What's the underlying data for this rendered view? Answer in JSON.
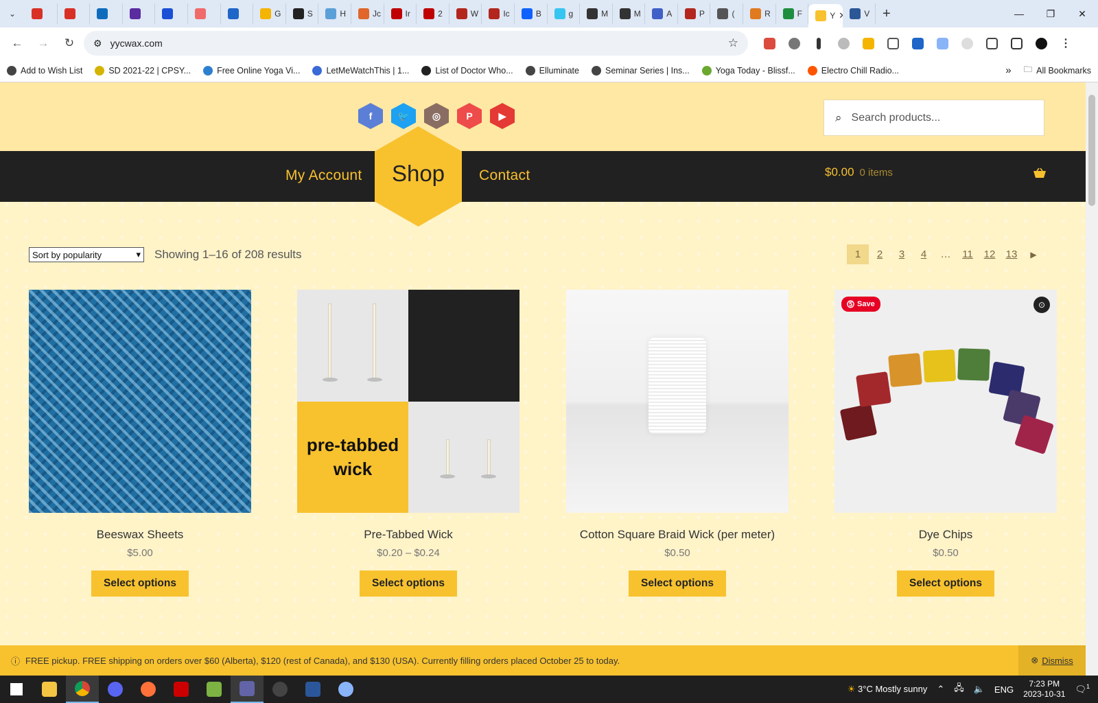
{
  "browser": {
    "tabs": [
      {
        "label": "",
        "color": "#d93025"
      },
      {
        "label": "",
        "color": "#d93025"
      },
      {
        "label": "",
        "color": "#0f6cbd"
      },
      {
        "label": "",
        "color": "#5a2ca0"
      },
      {
        "label": "",
        "color": "#1a4fd6"
      },
      {
        "label": "",
        "color": "#f06a6a"
      },
      {
        "label": "",
        "color": "#1e66c7"
      },
      {
        "label": "G",
        "color": "#f4b400"
      },
      {
        "label": "S",
        "color": "#222222"
      },
      {
        "label": "H",
        "color": "#5aa0d8"
      },
      {
        "label": "Jc",
        "color": "#e0662a"
      },
      {
        "label": "Ir",
        "color": "#c00000"
      },
      {
        "label": "2",
        "color": "#c00000"
      },
      {
        "label": "W",
        "color": "#b3261e"
      },
      {
        "label": "Ic",
        "color": "#b3261e"
      },
      {
        "label": "B",
        "color": "#0f62fe"
      },
      {
        "label": "g",
        "color": "#36c5f0"
      },
      {
        "label": "M",
        "color": "#333333"
      },
      {
        "label": "M",
        "color": "#333333"
      },
      {
        "label": "A",
        "color": "#4060c8"
      },
      {
        "label": "P",
        "color": "#b3261e"
      },
      {
        "label": "(",
        "color": "#555555"
      },
      {
        "label": "R",
        "color": "#e07a1f"
      },
      {
        "label": "F",
        "color": "#1e8e3e"
      },
      {
        "label": "Y",
        "color": "#f8c22f",
        "active": true
      },
      {
        "label": "V",
        "color": "#2b5797"
      }
    ],
    "new_tab": "+",
    "url": "yycwax.com",
    "bookmarks": [
      {
        "label": "Add to Wish List",
        "color": "#444444"
      },
      {
        "label": "SD 2021-22 | CPSY...",
        "color": "#d4b400"
      },
      {
        "label": "Free Online Yoga Vi...",
        "color": "#2f7fd0"
      },
      {
        "label": "LetMeWatchThis | 1...",
        "color": "#3a6ad6"
      },
      {
        "label": "List of Doctor Who...",
        "color": "#222222"
      },
      {
        "label": "Elluminate",
        "color": "#444444"
      },
      {
        "label": "Seminar Series | Ins...",
        "color": "#444444"
      },
      {
        "label": "Yoga Today - Blissf...",
        "color": "#6aa82f"
      },
      {
        "label": "Electro Chill Radio...",
        "color": "#ff5500"
      }
    ],
    "bookmarks_more": "»",
    "all_bookmarks": "All Bookmarks"
  },
  "site": {
    "search_placeholder": "Search products...",
    "nav": {
      "my_account": "My Account",
      "shop": "Shop",
      "contact": "Contact"
    },
    "cart": {
      "amount": "$0.00",
      "items": "0 items"
    },
    "sort": {
      "selected": "Sort by popularity"
    },
    "result_count": "Showing 1–16 of 208 results",
    "pagination": [
      "1",
      "2",
      "3",
      "4",
      "…",
      "11",
      "12",
      "13"
    ],
    "products": [
      {
        "name": "Beeswax Sheets",
        "price": "$5.00",
        "button": "Select options"
      },
      {
        "name": "Pre-Tabbed Wick",
        "price": "$0.20 – $0.24",
        "button": "Select options",
        "image_text": "pre-tabbed wick"
      },
      {
        "name": "Cotton Square Braid Wick (per meter)",
        "price": "$0.50",
        "button": "Select options"
      },
      {
        "name": "Dye Chips",
        "price": "$0.50",
        "button": "Select options",
        "save_badge": "Save"
      }
    ],
    "notice": {
      "text": "FREE pickup. FREE shipping on orders over $60 (Alberta), $120 (rest of Canada), and $130 (USA). Currently filling orders placed October 25 to today.",
      "dismiss": "Dismiss"
    },
    "colors": {
      "accent": "#f8c22f",
      "dark": "#222121",
      "background": "#fff3c8"
    }
  },
  "taskbar": {
    "weather": "3°C  Mostly sunny",
    "lang": "ENG",
    "time": "7:23 PM",
    "date": "2023-10-31",
    "notification_count": "1"
  }
}
